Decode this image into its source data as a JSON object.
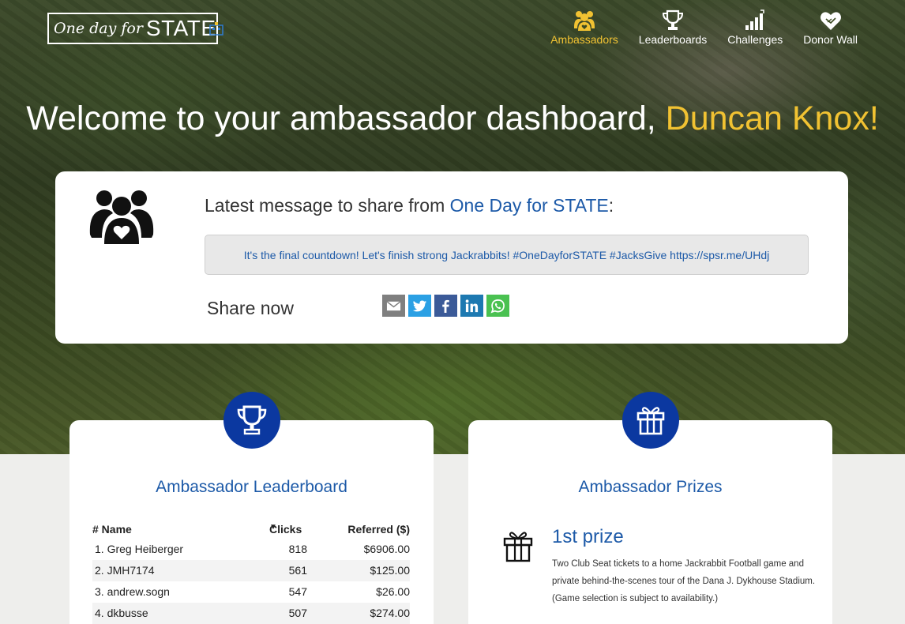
{
  "header": {
    "logo_script": "One day for",
    "logo_main": "STATE",
    "nav": [
      {
        "label": "Ambassadors",
        "icon": "people-icon",
        "active": true
      },
      {
        "label": "Leaderboards",
        "icon": "trophy-icon",
        "active": false
      },
      {
        "label": "Challenges",
        "icon": "bar-chart-icon",
        "active": false
      },
      {
        "label": "Donor Wall",
        "icon": "heart-hands-icon",
        "active": false
      }
    ]
  },
  "welcome": {
    "prefix": "Welcome to your ambassador dashboard, ",
    "name": "Duncan Knox!"
  },
  "message_card": {
    "title_prefix": "Latest message to share from ",
    "title_org": "One Day for STATE",
    "title_suffix": ":",
    "message": "It's the final countdown! Let's finish strong Jackrabbits! #OneDayforSTATE #JacksGive https://spsr.me/UHdj",
    "share_label": "Share now",
    "share_buttons": [
      "email-icon",
      "twitter-icon",
      "facebook-icon",
      "linkedin-icon",
      "whatsapp-icon"
    ]
  },
  "leaderboard": {
    "title": "Ambassador Leaderboard",
    "columns": {
      "name": "# Name",
      "clicks": "Clicks",
      "referred": "Referred ($)"
    },
    "rows": [
      {
        "name": "1. Greg Heiberger",
        "clicks": "818",
        "referred": "$6906.00"
      },
      {
        "name": "2. JMH7174",
        "clicks": "561",
        "referred": "$125.00"
      },
      {
        "name": "3. andrew.sogn",
        "clicks": "547",
        "referred": "$26.00"
      },
      {
        "name": "4. dkbusse",
        "clicks": "507",
        "referred": "$274.00"
      }
    ]
  },
  "prizes": {
    "title": "Ambassador Prizes",
    "items": [
      {
        "title": "1st prize",
        "description": "Two Club Seat tickets to a home Jackrabbit Football game and private behind-the-scenes tour of the Dana J. Dykhouse Stadium. (Game selection is subject to availability.)"
      }
    ]
  },
  "colors": {
    "accent_gold": "#f1c232",
    "brand_blue": "#1d5aa8",
    "badge_blue": "#0b38a0"
  }
}
